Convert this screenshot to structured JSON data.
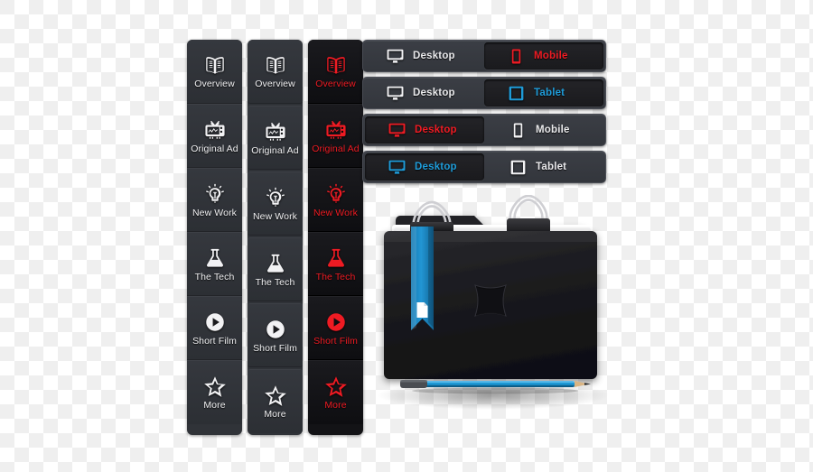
{
  "menu_columns": [
    {
      "name": "column-white-on-gray",
      "theme": "theme-dark",
      "items": [
        {
          "label": "Overview",
          "icon": "open-book-icon"
        },
        {
          "label": "Original Ad",
          "icon": "television-icon"
        },
        {
          "label": "New Work",
          "icon": "lightbulb-icon"
        },
        {
          "label": "The Tech",
          "icon": "flask-icon"
        },
        {
          "label": "Short Film",
          "icon": "play-circle-icon"
        },
        {
          "label": "More",
          "icon": "star-icon"
        }
      ]
    },
    {
      "name": "column-white-on-gray-separated",
      "theme": "theme-dark2",
      "items": [
        {
          "label": "Overview",
          "icon": "open-book-icon"
        },
        {
          "label": "Original Ad",
          "icon": "television-icon"
        },
        {
          "label": "New Work",
          "icon": "lightbulb-icon"
        },
        {
          "label": "The Tech",
          "icon": "flask-icon"
        },
        {
          "label": "Short Film",
          "icon": "play-circle-icon"
        },
        {
          "label": "More",
          "icon": "star-icon"
        }
      ]
    },
    {
      "name": "column-red-on-black",
      "theme": "theme-black",
      "items": [
        {
          "label": "Overview",
          "icon": "open-book-icon"
        },
        {
          "label": "Original Ad",
          "icon": "television-icon"
        },
        {
          "label": "New Work",
          "icon": "lightbulb-icon"
        },
        {
          "label": "The Tech",
          "icon": "flask-icon"
        },
        {
          "label": "Short Film",
          "icon": "play-circle-icon"
        },
        {
          "label": "More",
          "icon": "star-icon"
        }
      ]
    }
  ],
  "toggle_bars": [
    {
      "name": "desktop-mobile-bar",
      "segments": [
        {
          "label": "Desktop",
          "icon": "monitor-icon",
          "accent": "white",
          "active": false
        },
        {
          "label": "Mobile",
          "icon": "smartphone-icon",
          "accent": "red",
          "active": true
        }
      ]
    },
    {
      "name": "desktop-tablet-bar",
      "segments": [
        {
          "label": "Desktop",
          "icon": "monitor-icon",
          "accent": "white",
          "active": false
        },
        {
          "label": "Tablet",
          "icon": "tablet-icon",
          "accent": "blue",
          "active": true
        }
      ]
    },
    {
      "name": "desktop-active-mobile-bar",
      "segments": [
        {
          "label": "Desktop",
          "icon": "monitor-icon",
          "accent": "red",
          "active": true
        },
        {
          "label": "Mobile",
          "icon": "smartphone-icon",
          "accent": "white",
          "active": false
        }
      ]
    },
    {
      "name": "desktop-active-tablet-bar",
      "segments": [
        {
          "label": "Desktop",
          "icon": "monitor-icon",
          "accent": "blue",
          "active": true
        },
        {
          "label": "Tablet",
          "icon": "tablet-icon",
          "accent": "white",
          "active": false
        }
      ]
    }
  ],
  "illustration": {
    "name": "black-folder-illustration",
    "parts": [
      "folder-back-tab",
      "paper-sheets",
      "binder-clip-left",
      "binder-clip-right",
      "folder-front-cover",
      "blue-bookmark-ribbon",
      "document-icon-on-ribbon",
      "embossed-cutout",
      "blue-pencil"
    ]
  },
  "colors": {
    "accent_red": "#ee1b23",
    "accent_blue": "#1e9bd8",
    "panel_gray": "#33363c",
    "panel_black": "#131316",
    "tile_text": "#f0f0f2",
    "folder_black": "#1b1b1e",
    "ribbon_blue": "#1b83bd",
    "pencil_blue": "#1e9bd8"
  }
}
